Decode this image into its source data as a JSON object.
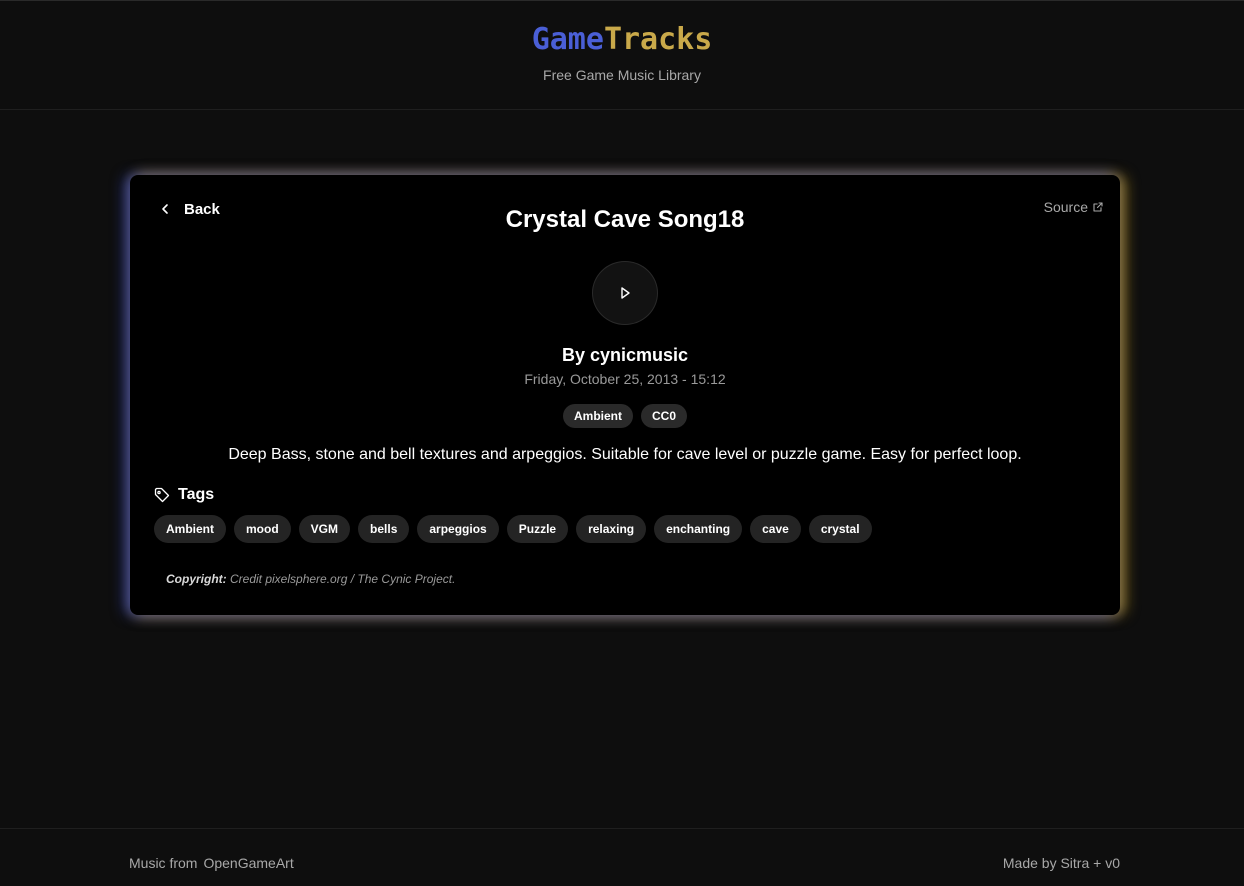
{
  "header": {
    "logo_part1": "Game",
    "logo_part2": "Tracks",
    "tagline": "Free Game Music Library",
    "logo_colors": {
      "game": "#4a5fd6",
      "tracks": "#c9a94a"
    }
  },
  "track": {
    "back_label": "Back",
    "source_label": "Source",
    "title": "Crystal Cave Song18",
    "artist": "By cynicmusic",
    "date": "Friday, October 25, 2013 - 15:12",
    "badges": [
      "Ambient",
      "CC0"
    ],
    "description": "Deep Bass, stone and bell textures and arpeggios. Suitable for cave level or puzzle game. Easy for perfect loop.",
    "tags_heading": "Tags",
    "tags": [
      "Ambient",
      "mood",
      "VGM",
      "bells",
      "arpeggios",
      "Puzzle",
      "relaxing",
      "enchanting",
      "cave",
      "crystal"
    ],
    "copyright_label": "Copyright:",
    "copyright_text": "Credit pixelsphere.org / The Cynic Project."
  },
  "footer": {
    "music_from": "Music from",
    "music_source": "OpenGameArt",
    "made_by": "Made by Sitra + v0"
  },
  "icons": {
    "back": "chevron-left-icon",
    "source": "external-link-icon",
    "play": "play-icon",
    "tags": "tag-icon"
  }
}
